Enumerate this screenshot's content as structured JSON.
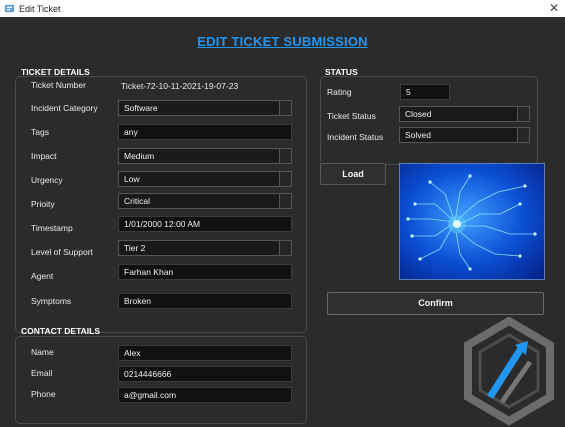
{
  "window": {
    "title": "Edit Ticket",
    "close_label": "✕"
  },
  "heading": "EDIT TICKET SUBMISSION",
  "ticket_details": {
    "title": "TICKET DETAILS",
    "ticket_number_label": "Ticket Number",
    "ticket_number_value": "Ticket-72-10-11-2021-19-07-23",
    "incident_category_label": "Incident Category",
    "incident_category_value": "Software",
    "tags_label": "Tags",
    "tags_value": "any",
    "impact_label": "Impact",
    "impact_value": "Medium",
    "urgency_label": "Urgency",
    "urgency_value": "Low",
    "priority_label": "Prioity",
    "priority_value": "Critical",
    "timestamp_label": "Timestamp",
    "timestamp_value": "1/01/2000 12:00 AM",
    "level_label": "Level of Support",
    "level_value": "Tier 2",
    "agent_label": "Agent",
    "agent_value": "Farhan Khan",
    "symptoms_label": "Symptoms",
    "symptoms_value": "Broken"
  },
  "contact_details": {
    "title": "CONTACT DETAILS",
    "name_label": "Name",
    "name_value": "Alex",
    "email_label": "Email",
    "email_value": "0214446666",
    "phone_label": "Phone",
    "phone_value": "a@gmail.com"
  },
  "status": {
    "title": "STATUS",
    "rating_label": "Rating",
    "rating_value": "5",
    "ticket_status_label": "Ticket Status",
    "ticket_status_value": "Closed",
    "incident_status_label": "Incident Status",
    "incident_status_value": "Solved"
  },
  "buttons": {
    "load": "Load",
    "confirm": "Confirm"
  },
  "colors": {
    "accent": "#2196f3",
    "background": "#2b2b2b",
    "field": "#111111"
  },
  "icons": {
    "app": "ticket-app-icon",
    "close": "close-icon",
    "image": "circuit-image",
    "logo": "brand-logo"
  }
}
